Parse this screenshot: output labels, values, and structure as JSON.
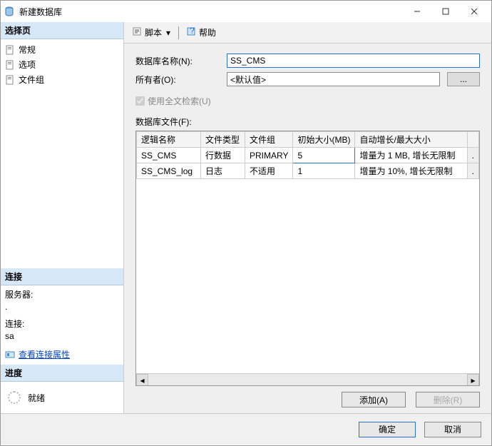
{
  "window": {
    "title": "新建数据库"
  },
  "left": {
    "select_page": "选择页",
    "items": [
      {
        "label": "常规"
      },
      {
        "label": "选项"
      },
      {
        "label": "文件组"
      }
    ],
    "connection_head": "连接",
    "server_label": "服务器:",
    "server_value": ".",
    "conn_label": "连接:",
    "conn_value": "sa",
    "view_props": "查看连接属性",
    "progress_head": "进度",
    "ready": "就绪"
  },
  "toolbar": {
    "script": "脚本",
    "help": "帮助"
  },
  "form": {
    "db_name_label": "数据库名称(N):",
    "db_name_value": "SS_CMS",
    "owner_label": "所有者(O):",
    "owner_value": "<默认值>",
    "owner_btn": "...",
    "fulltext": "使用全文检索(U)",
    "files_label": "数据库文件(F):"
  },
  "grid": {
    "headers": [
      "逻辑名称",
      "文件类型",
      "文件组",
      "初始大小(MB)",
      "自动增长/最大大小"
    ],
    "rows": [
      {
        "name": "SS_CMS",
        "type": "行数据",
        "group": "PRIMARY",
        "size": "5",
        "growth": "增量为 1 MB, 增长无限制"
      },
      {
        "name": "SS_CMS_log",
        "type": "日志",
        "group": "不适用",
        "size": "1",
        "growth": "增量为 10%, 增长无限制"
      }
    ]
  },
  "buttons": {
    "add": "添加(A)",
    "remove": "删除(R)",
    "ok": "确定",
    "cancel": "取消"
  }
}
